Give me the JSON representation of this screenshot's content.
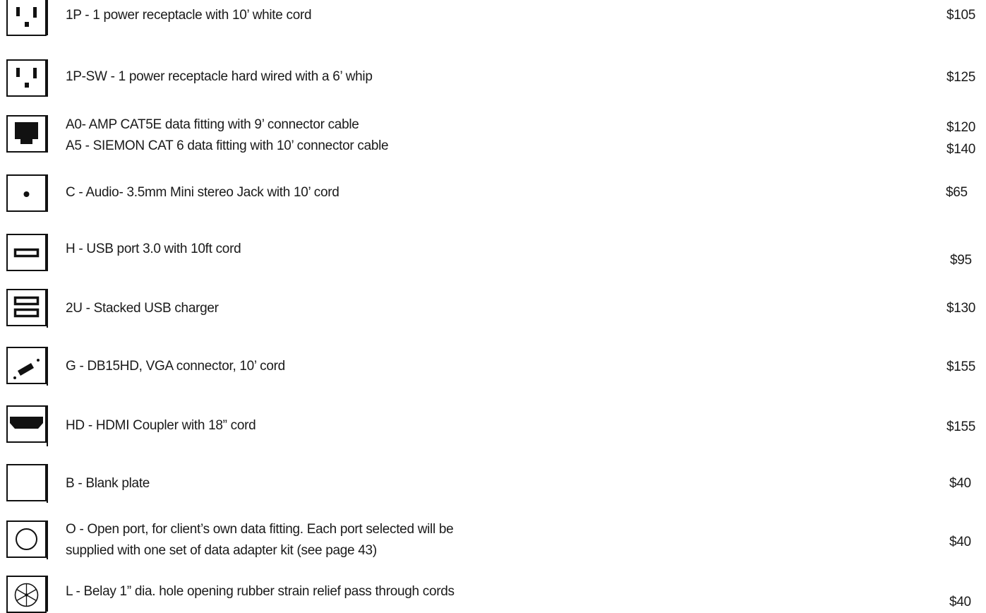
{
  "items": [
    {
      "description": "1P - 1 power receptacle with 10’ white cord",
      "price": "$105",
      "icon": "power-outlet-icon"
    },
    {
      "description": "1P-SW - 1 power receptacle hard wired with a 6’ whip",
      "price": "$125",
      "icon": "power-outlet-icon"
    },
    {
      "description": "A0- AMP CAT5E data fitting with 9’ connector cable",
      "price": "$120",
      "icon": "ethernet-jack-icon"
    },
    {
      "description": "A5 - SIEMON CAT 6 data fitting with 10’ connector cable",
      "price": "$140",
      "icon": "ethernet-jack-icon"
    },
    {
      "description": "C - Audio- 3.5mm Mini stereo Jack with 10’ cord",
      "price": "$65",
      "icon": "audio-jack-icon"
    },
    {
      "description": "H - USB port 3.0 with 10ft cord",
      "price": "$95",
      "icon": "usb-port-icon"
    },
    {
      "description": "2U - Stacked USB charger",
      "price": "$130",
      "icon": "stacked-usb-icon"
    },
    {
      "description": "G - DB15HD, VGA connector, 10’ cord",
      "price": "$155",
      "icon": "vga-connector-icon"
    },
    {
      "description": "HD - HDMI Coupler with 18” cord",
      "price": "$155",
      "icon": "hdmi-port-icon"
    },
    {
      "description": "B - Blank plate",
      "price": "$40",
      "icon": "blank-plate-icon"
    },
    {
      "description_line1": "O - Open port, for client’s own data fitting. Each port selected will be",
      "description_line2": "supplied with one set of data adapter kit (see page 43)",
      "price": "$40",
      "icon": "open-port-icon"
    },
    {
      "description": "L - Belay 1” dia. hole opening rubber strain relief pass through cords",
      "price": "$40",
      "icon": "strain-relief-icon"
    }
  ]
}
